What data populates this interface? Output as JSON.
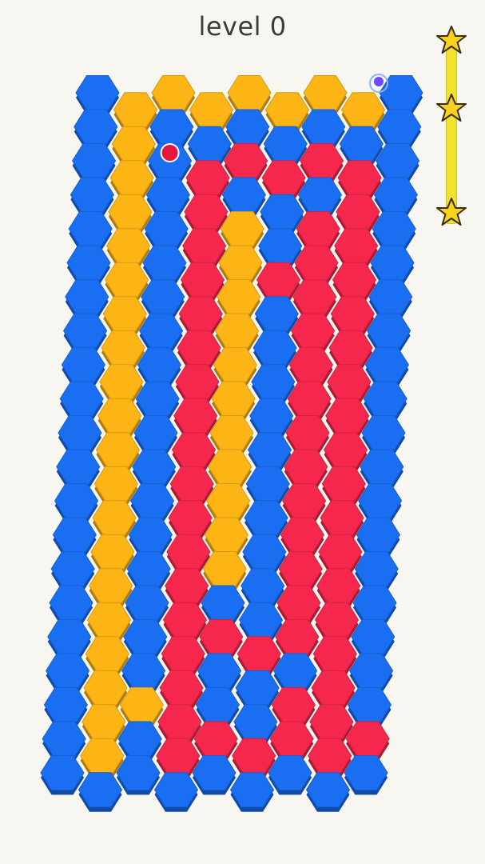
{
  "header": {
    "level_label": "level 0"
  },
  "colors": {
    "blue": "#1a6ef2",
    "yellow": "#fdb515",
    "red": "#f5274d",
    "star": "#f8d21c",
    "progress": "#f2e22a"
  },
  "progress": {
    "stars_total": 3,
    "fill_fraction": 1.0
  },
  "board": {
    "cols": 9,
    "rows": 21,
    "yellow_cells": [
      [
        1,
        0
      ],
      [
        2,
        0
      ],
      [
        3,
        0
      ],
      [
        4,
        0
      ],
      [
        5,
        0
      ],
      [
        6,
        0
      ],
      [
        7,
        0
      ],
      [
        1,
        1
      ],
      [
        1,
        2
      ],
      [
        1,
        3
      ],
      [
        1,
        4
      ],
      [
        1,
        5
      ],
      [
        1,
        6
      ],
      [
        1,
        7
      ],
      [
        1,
        8
      ],
      [
        1,
        9
      ],
      [
        1,
        10
      ],
      [
        1,
        11
      ],
      [
        1,
        12
      ],
      [
        1,
        13
      ],
      [
        1,
        14
      ],
      [
        1,
        15
      ],
      [
        1,
        16
      ],
      [
        1,
        17
      ],
      [
        1,
        18
      ],
      [
        1,
        19
      ],
      [
        2,
        18
      ],
      [
        4,
        4
      ],
      [
        4,
        5
      ],
      [
        4,
        6
      ],
      [
        4,
        7
      ],
      [
        4,
        8
      ],
      [
        4,
        9
      ],
      [
        4,
        10
      ],
      [
        4,
        11
      ],
      [
        4,
        12
      ],
      [
        4,
        13
      ],
      [
        4,
        14
      ]
    ],
    "red_cells": [
      [
        3,
        2
      ],
      [
        4,
        2
      ],
      [
        5,
        2
      ],
      [
        6,
        2
      ],
      [
        7,
        2
      ],
      [
        3,
        3
      ],
      [
        3,
        4
      ],
      [
        3,
        5
      ],
      [
        3,
        6
      ],
      [
        3,
        7
      ],
      [
        3,
        8
      ],
      [
        3,
        9
      ],
      [
        3,
        10
      ],
      [
        3,
        11
      ],
      [
        3,
        12
      ],
      [
        3,
        13
      ],
      [
        3,
        14
      ],
      [
        3,
        15
      ],
      [
        3,
        16
      ],
      [
        3,
        17
      ],
      [
        4,
        16
      ],
      [
        5,
        16
      ],
      [
        6,
        16
      ],
      [
        7,
        3
      ],
      [
        7,
        4
      ],
      [
        7,
        5
      ],
      [
        7,
        6
      ],
      [
        7,
        7
      ],
      [
        7,
        8
      ],
      [
        7,
        9
      ],
      [
        7,
        10
      ],
      [
        7,
        11
      ],
      [
        7,
        12
      ],
      [
        7,
        13
      ],
      [
        7,
        14
      ],
      [
        7,
        15
      ],
      [
        7,
        16
      ],
      [
        7,
        17
      ],
      [
        7,
        18
      ],
      [
        6,
        4
      ],
      [
        6,
        5
      ],
      [
        6,
        6
      ],
      [
        6,
        7
      ],
      [
        6,
        8
      ],
      [
        6,
        9
      ],
      [
        6,
        10
      ],
      [
        6,
        11
      ],
      [
        6,
        12
      ],
      [
        6,
        13
      ],
      [
        6,
        14
      ],
      [
        6,
        15
      ],
      [
        3,
        18
      ],
      [
        3,
        19
      ],
      [
        4,
        19
      ],
      [
        5,
        19
      ],
      [
        6,
        19
      ],
      [
        6,
        18
      ],
      [
        7,
        19
      ],
      [
        8,
        19
      ],
      [
        5,
        5
      ]
    ],
    "player_cell": [
      2,
      2
    ],
    "goal_cell": [
      8,
      0
    ]
  }
}
